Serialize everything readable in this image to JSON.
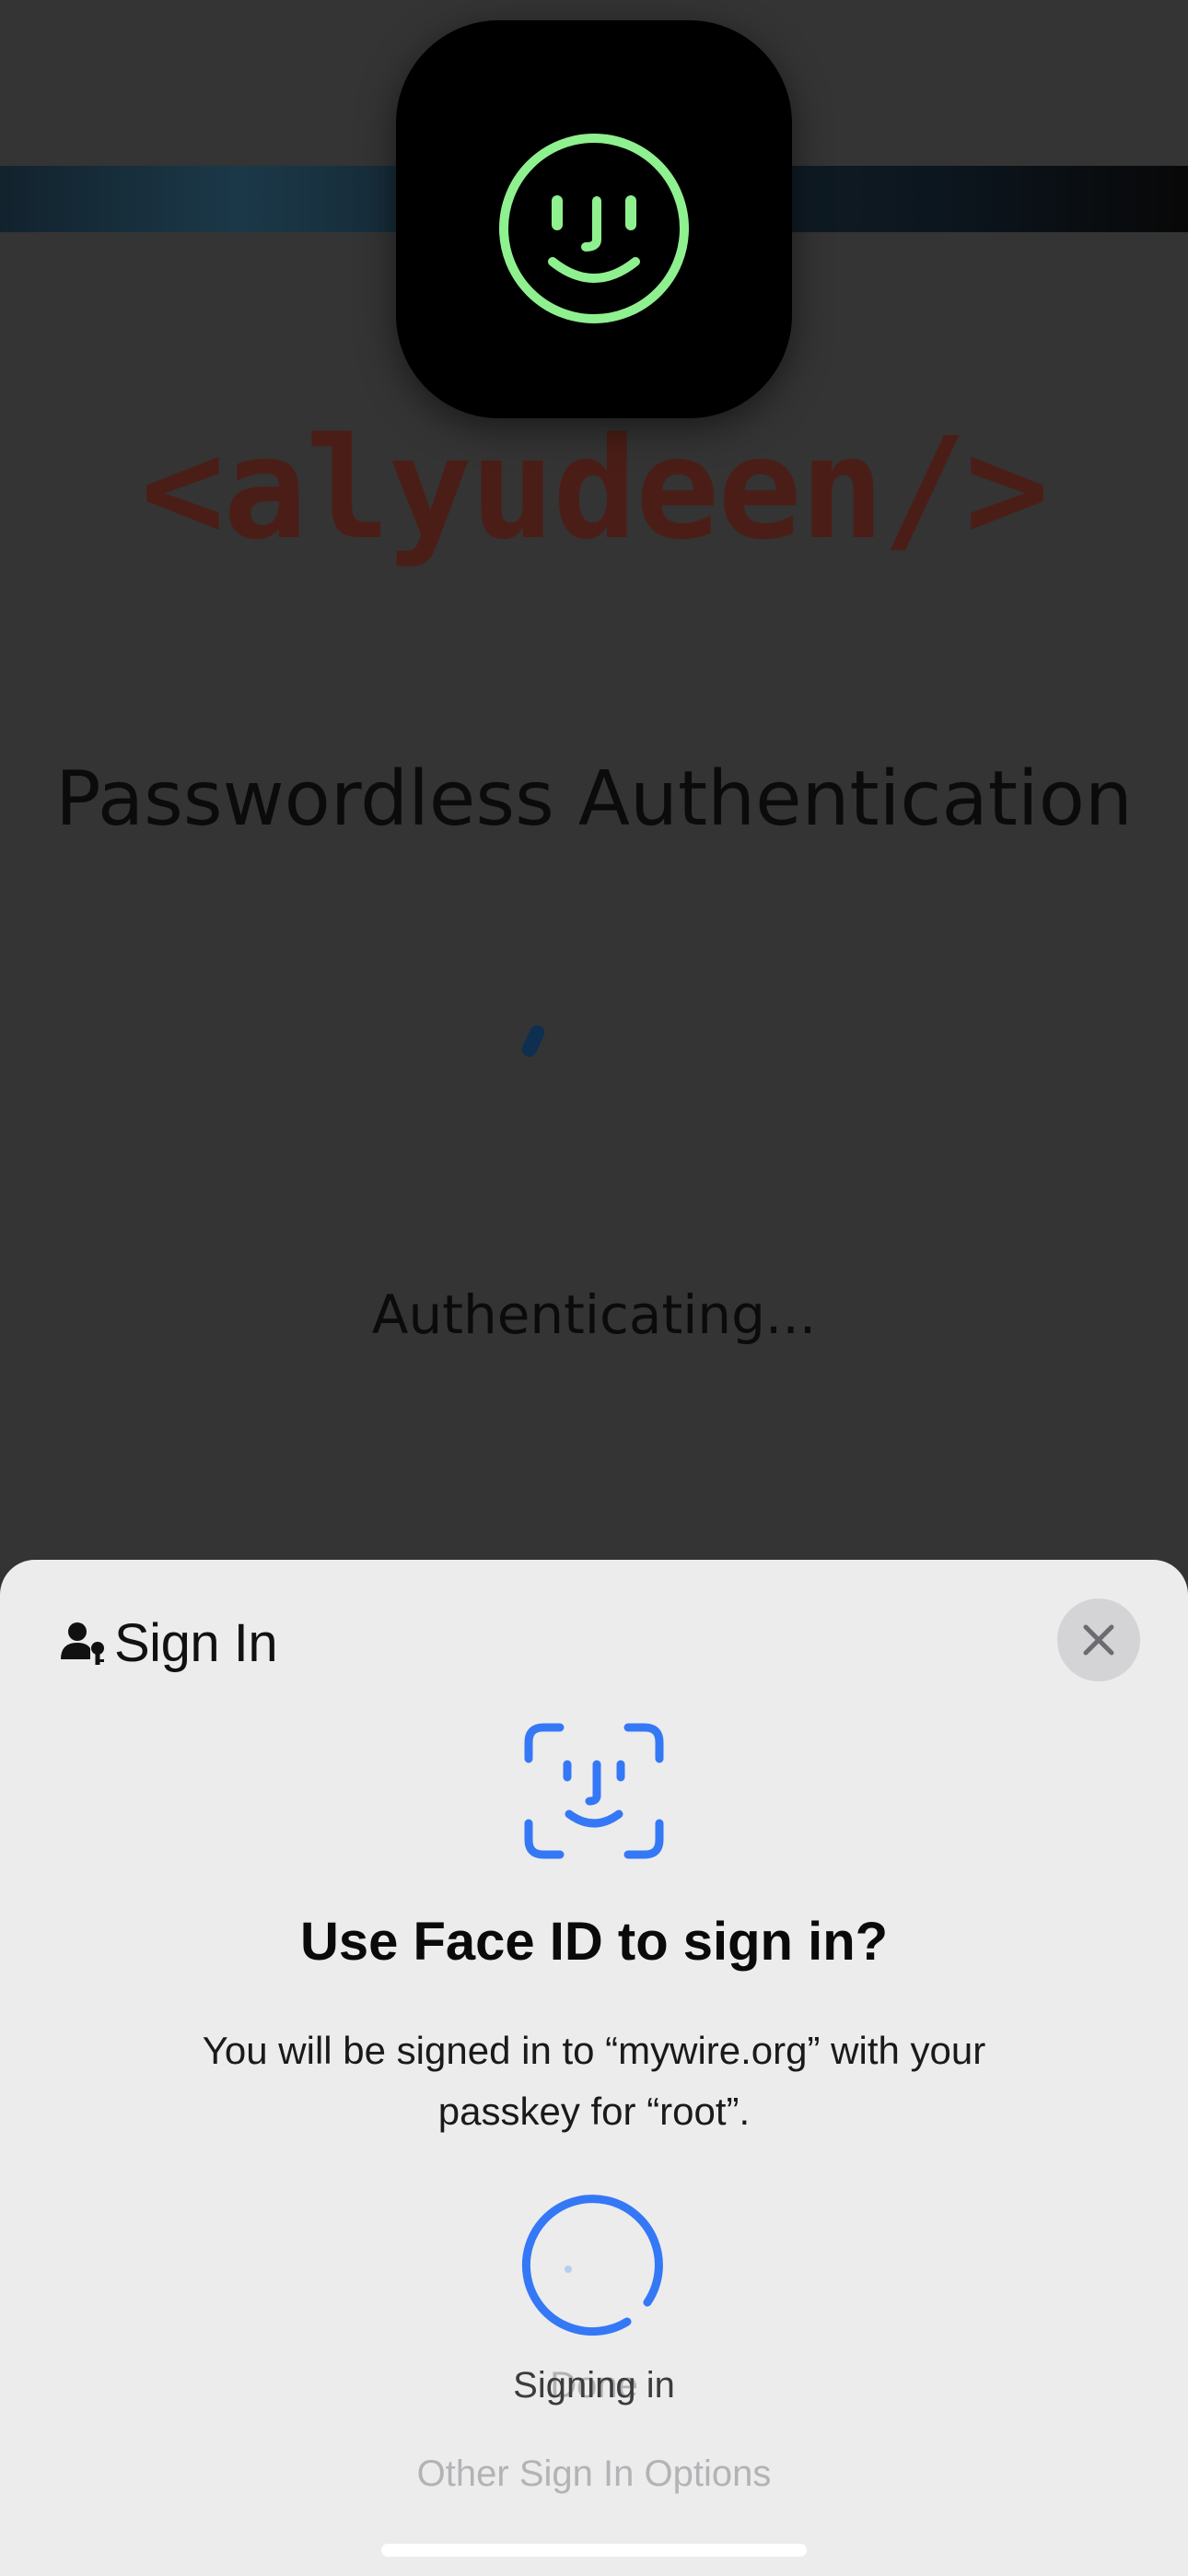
{
  "background": {
    "logo_text": "<alyudeen/>",
    "page_title": "Passwordless Authentication",
    "status_text": "Authenticating..."
  },
  "hud": {
    "icon": "face-id-smile-icon",
    "accent_color": "#8ff08f"
  },
  "sheet": {
    "title": "Sign In",
    "header_icon": "person-key-icon",
    "close_icon": "close-icon",
    "prompt_icon": "face-id-icon",
    "prompt_title": "Use Face ID to sign in?",
    "prompt_body": "You will be signed in to “mywire.org” with your passkey for “root”.",
    "status_done": "Done",
    "status_signing": "Signing in",
    "other_options": "Other Sign In Options",
    "accent_color": "#3478f6"
  }
}
